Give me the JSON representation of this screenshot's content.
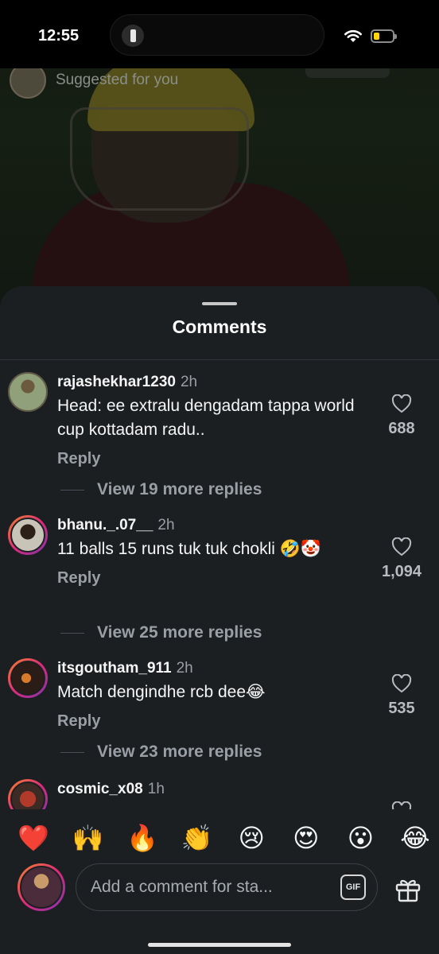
{
  "status_bar": {
    "time": "12:55"
  },
  "background": {
    "suggested_label": "Suggested for you"
  },
  "sheet": {
    "title": "Comments"
  },
  "comments": [
    {
      "username": "rajashekhar1230",
      "time_ago": "2h",
      "text": "Head: ee extralu dengadam tappa world cup kottadam radu..",
      "reply_label": "Reply",
      "view_replies": "View 19 more replies",
      "likes": "688"
    },
    {
      "username": "bhanu._.07__",
      "time_ago": "2h",
      "text": "11 balls 15 runs tuk tuk chokli 🤣🤡",
      "reply_label": "Reply",
      "view_replies": "View 25 more replies",
      "likes": "1,094"
    },
    {
      "username": "itsgoutham_911",
      "time_ago": "2h",
      "text": "Match dengindhe rcb dee😂",
      "reply_label": "Reply",
      "view_replies": "View 23 more replies",
      "likes": "535"
    },
    {
      "username": "cosmic_x08",
      "time_ago": "1h"
    }
  ],
  "emoji_bar": [
    "❤️",
    "🙌",
    "🔥",
    "👏",
    "😢",
    "😍",
    "😮",
    "😂"
  ],
  "composer": {
    "placeholder": "Add a comment for sta...",
    "gif_label": "GIF"
  },
  "icons": {
    "like": "heart-icon",
    "gift": "gift-icon",
    "wifi": "wifi-icon",
    "battery": "battery-icon",
    "flashlight": "flashlight-icon"
  },
  "colors": {
    "sheet_bg": "#1c1f22",
    "secondary_text": "#9a9fa5",
    "battery_level": "#ffd60a",
    "story_ring_start": "#f58529",
    "story_ring_end": "#8134af"
  }
}
